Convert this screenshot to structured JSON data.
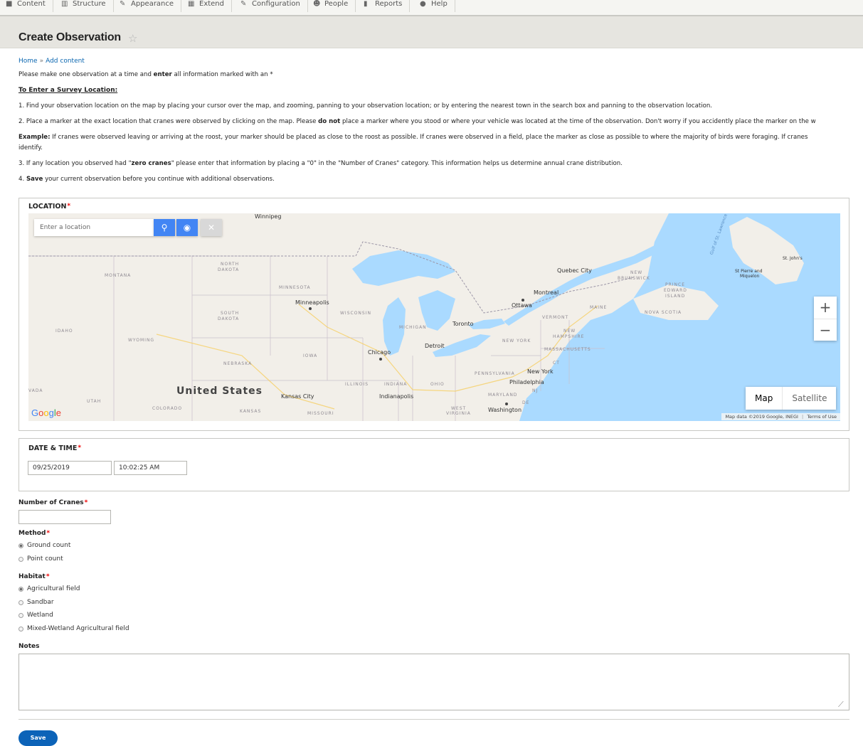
{
  "toolbar": {
    "items": [
      {
        "label": "Content",
        "icon": "content-icon"
      },
      {
        "label": "Structure",
        "icon": "structure-icon"
      },
      {
        "label": "Appearance",
        "icon": "appearance-icon"
      },
      {
        "label": "Extend",
        "icon": "extend-icon"
      },
      {
        "label": "Configuration",
        "icon": "configuration-icon"
      },
      {
        "label": "People",
        "icon": "people-icon"
      },
      {
        "label": "Reports",
        "icon": "reports-icon"
      },
      {
        "label": "Help",
        "icon": "help-icon"
      }
    ]
  },
  "header": {
    "title": "Create Observation",
    "star": "☆"
  },
  "breadcrumb": {
    "home": "Home",
    "sep": "»",
    "current": "Add content"
  },
  "intro": {
    "line1_pre": "Please make one observation at a time and ",
    "line1_bold": "enter",
    "line1_post": " all information marked with an *",
    "heading": "To Enter a Survey Location:",
    "step1": "1. Find your observation location on the map by placing your cursor over the map, and zooming, panning to your observation location; or by entering the nearest town in the search box and panning to the observation location.",
    "step2_pre": "2. Place a marker at the exact location that cranes were observed by clicking on the map. Please ",
    "step2_bold": "do not",
    "step2_post": " place a marker where you stood or where your vehicle was located at the time of the observation. Don't worry if you accidently place the marker on the w",
    "example_bold": "Example:",
    "example_text": " If cranes were observed leaving or arriving at the roost, your marker should be placed as close to the roost as possible. If cranes were observed in a field, place the marker as close as possible to where the majority of birds were foraging. If cranes",
    "example_cont": "identify.",
    "step3_pre": "3. If any location you observed had \"",
    "step3_bold": "zero cranes",
    "step3_post": "\" please enter that information by placing a \"0\" in the \"Number of Cranes\" category. This information helps us determine annual crane distribution.",
    "step4_bold": "Save",
    "step4_pre": "4. ",
    "step4_post": " your current observation before you continue with additional observations."
  },
  "location": {
    "legend": "LOCATION",
    "search_placeholder": "Enter a location",
    "search_icon": "search-icon",
    "locate_icon": "locate-icon",
    "clear_icon": "clear-icon",
    "zoom_in": "+",
    "zoom_out": "−",
    "map_type_map": "Map",
    "map_type_satellite": "Satellite",
    "attribution_data": "Map data ©2019 Google, INEGI",
    "attribution_terms": "Terms of Use",
    "google_logo": "Google",
    "labels": {
      "winnipeg": "Winnipeg",
      "montana": "MONTANA",
      "north_dakota_1": "NORTH",
      "north_dakota_2": "DAKOTA",
      "minnesota": "MINNESOTA",
      "minneapolis": "Minneapolis",
      "south_dakota_1": "SOUTH",
      "south_dakota_2": "DAKOTA",
      "wisconsin": "WISCONSIN",
      "idaho": "IDAHO",
      "wyoming": "WYOMING",
      "michigan": "MICHIGAN",
      "toronto": "Toronto",
      "iowa": "IOWA",
      "nebraska": "NEBRASKA",
      "chicago": "Chicago",
      "detroit": "Detroit",
      "united_states": "United States",
      "illinois": "ILLINOIS",
      "indiana": "INDIANA",
      "ohio": "OHIO",
      "indianapolis": "Indianapolis",
      "nevada": "VADA",
      "utah": "UTAH",
      "colorado": "COLORADO",
      "kansas_city": "Kansas City",
      "kansas": "KANSAS",
      "missouri": "MISSOURI",
      "quebec_city": "Quebec City",
      "montreal": "Montreal",
      "ottawa": "Ottawa",
      "maine": "MAINE",
      "vermont": "VERMONT",
      "new_hampshire_1": "NEW",
      "new_hampshire_2": "HAMPSHIRE",
      "new_york_state": "NEW YORK",
      "massachusetts": "MASSACHUSETTS",
      "ct": "CT",
      "new_york": "New York",
      "pennsylvania": "PENNSYLVANIA",
      "philadelphia": "Philadelphia",
      "nj": "NJ",
      "maryland": "MARYLAND",
      "de": "DE",
      "washington": "Washington",
      "west_virginia_1": "WEST",
      "west_virginia_2": "VIRGINIA",
      "new_brunswick_1": "NEW",
      "new_brunswick_2": "BRUNSWICK",
      "pei_1": "PRINCE",
      "pei_2": "EDWARD",
      "pei_3": "ISLAND",
      "nova_scotia": "NOVA SCOTIA",
      "st_pierre_1": "St Pierre and",
      "st_pierre_2": "Miquelon",
      "st_johns": "St. John's",
      "gulf": "Gulf of St. Lawrence"
    }
  },
  "datetime": {
    "legend": "DATE & TIME",
    "date": "09/25/2019",
    "time": "10:02:25 AM"
  },
  "cranes": {
    "label": "Number of Cranes",
    "value": ""
  },
  "method": {
    "label": "Method",
    "options": [
      "Ground count",
      "Point count"
    ],
    "selected": 0
  },
  "habitat": {
    "label": "Habitat",
    "options": [
      "Agricultural field",
      "Sandbar",
      "Wetland",
      "Mixed-Wetland Agricultural field"
    ],
    "selected": 0
  },
  "notes": {
    "label": "Notes",
    "value": ""
  },
  "save": {
    "label": "Save"
  },
  "colors": {
    "accent": "#0c63b8",
    "map_button": "#4285f4",
    "water": "#aadaff",
    "land": "#f2efe9",
    "required": "#e00000"
  }
}
